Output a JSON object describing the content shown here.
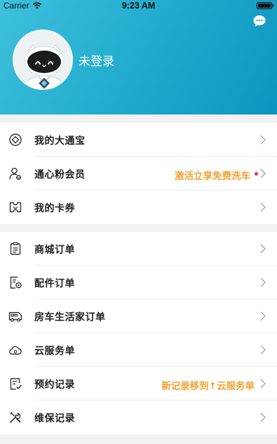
{
  "status_bar": {
    "carrier": "Carrier",
    "time": "9:23 AM"
  },
  "header": {
    "login_status": "未登录",
    "gradient": [
      "#3dc1dc",
      "#0e95bf"
    ]
  },
  "groups": [
    {
      "items": [
        {
          "label": "我的大通宝",
          "icon": "diamond-icon"
        },
        {
          "label": "通心粉会员",
          "icon": "member-icon",
          "hint": "激活立享免费洗车",
          "badge": true
        },
        {
          "label": "我的卡券",
          "icon": "ticket-icon"
        }
      ]
    },
    {
      "items": [
        {
          "label": "商城订单",
          "icon": "clipboard-icon"
        },
        {
          "label": "配件订单",
          "icon": "parts-order-icon"
        },
        {
          "label": "房车生活家订单",
          "icon": "rv-icon"
        },
        {
          "label": "云服务单",
          "icon": "cloud-icon"
        },
        {
          "label": "预约记录",
          "icon": "appointment-icon",
          "hint": "新记录移到↑云服务单"
        },
        {
          "label": "维保记录",
          "icon": "tools-icon"
        }
      ]
    }
  ],
  "colors": {
    "hint": "#f0a334",
    "badge": "#e8374a"
  }
}
